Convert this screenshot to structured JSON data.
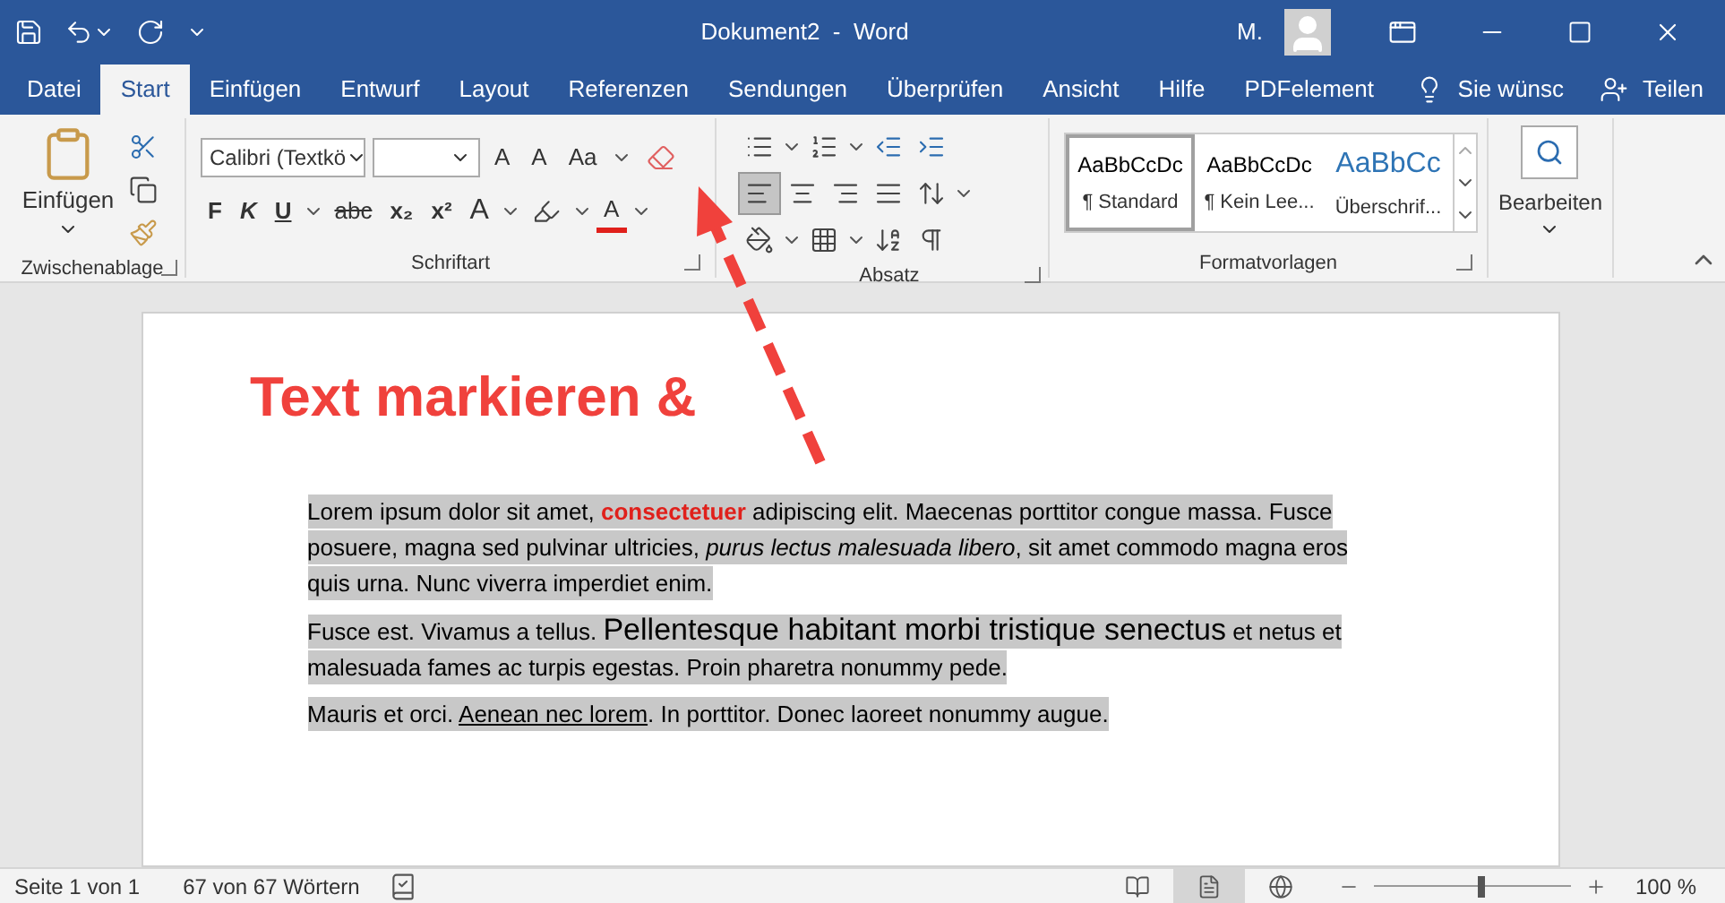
{
  "title_bar": {
    "title": "Dokument2  -  Word",
    "user": "M."
  },
  "tabs": [
    {
      "label": "Datei",
      "selected": false
    },
    {
      "label": "Start",
      "selected": true
    },
    {
      "label": "Einfügen",
      "selected": false
    },
    {
      "label": "Entwurf",
      "selected": false
    },
    {
      "label": "Layout",
      "selected": false
    },
    {
      "label": "Referenzen",
      "selected": false
    },
    {
      "label": "Sendungen",
      "selected": false
    },
    {
      "label": "Überprüfen",
      "selected": false
    },
    {
      "label": "Ansicht",
      "selected": false
    },
    {
      "label": "Hilfe",
      "selected": false
    },
    {
      "label": "PDFelement",
      "selected": false
    }
  ],
  "tell_me": "Sie wünsc",
  "share": "Teilen",
  "clipboard": {
    "paste": "Einfügen",
    "label": "Zwischenablage"
  },
  "font": {
    "name": "Calibri (Textkö",
    "label": "Schriftart",
    "grow": "A",
    "shrink": "A",
    "case": "Aa",
    "bold": "F",
    "italic": "K",
    "underline": "U",
    "strike": "abc",
    "subscript": "x₂",
    "superscript": "x²",
    "effects": "A",
    "color_letter": "A"
  },
  "paragraph": {
    "label": "Absatz",
    "alignments": [
      {
        "kind": "left",
        "selected": true
      },
      {
        "kind": "center",
        "selected": false
      },
      {
        "kind": "right",
        "selected": false
      },
      {
        "kind": "justify",
        "selected": false
      }
    ]
  },
  "styles": {
    "label": "Formatvorlagen",
    "items": [
      {
        "preview": "AaBbCcDc",
        "name": "¶ Standard",
        "kind": "normal",
        "selected": true
      },
      {
        "preview": "AaBbCcDc",
        "name": "¶ Kein Lee...",
        "kind": "normal",
        "selected": false
      },
      {
        "preview": "AaBbCc",
        "name": "Überschrif...",
        "kind": "heading",
        "selected": false
      }
    ]
  },
  "editing": {
    "label": "Bearbeiten"
  },
  "document": {
    "heading": "Text markieren &",
    "paragraphs": [
      {
        "selected": true,
        "segments": [
          {
            "kind": "plain",
            "text": "Lorem ipsum dolor sit amet, "
          },
          {
            "kind": "bold-red",
            "text": "consectetuer"
          },
          {
            "kind": "plain",
            "text": " adipiscing elit. Maecenas porttitor congue massa. Fusce posuere, magna sed pulvinar ultricies, "
          },
          {
            "kind": "italic",
            "text": "purus lectus malesuada libero"
          },
          {
            "kind": "plain",
            "text": ", sit amet commodo magna eros quis urna. Nunc viverra imperdiet enim."
          }
        ]
      },
      {
        "selected": true,
        "segments": [
          {
            "kind": "plain",
            "text": "Fusce est. Vivamus a tellus. "
          },
          {
            "kind": "large",
            "text": "Pellentesque habitant morbi tristique senectus"
          },
          {
            "kind": "plain",
            "text": " et netus et malesuada fames ac turpis egestas. Proin pharetra nonummy pede."
          }
        ]
      },
      {
        "selected": true,
        "segments": [
          {
            "kind": "plain",
            "text": "Mauris et orci. "
          },
          {
            "kind": "underline",
            "text": "Aenean nec lorem"
          },
          {
            "kind": "plain",
            "text": ". In porttitor. Donec laoreet nonummy augue."
          }
        ]
      }
    ]
  },
  "status_bar": {
    "page": "Seite 1 von 1",
    "words": "67 von 67 Wörtern",
    "views": [
      {
        "kind": "read",
        "selected": false
      },
      {
        "kind": "print",
        "selected": true
      },
      {
        "kind": "web",
        "selected": false
      }
    ],
    "zoom": {
      "level": 0.55,
      "reading": "100 %"
    }
  }
}
